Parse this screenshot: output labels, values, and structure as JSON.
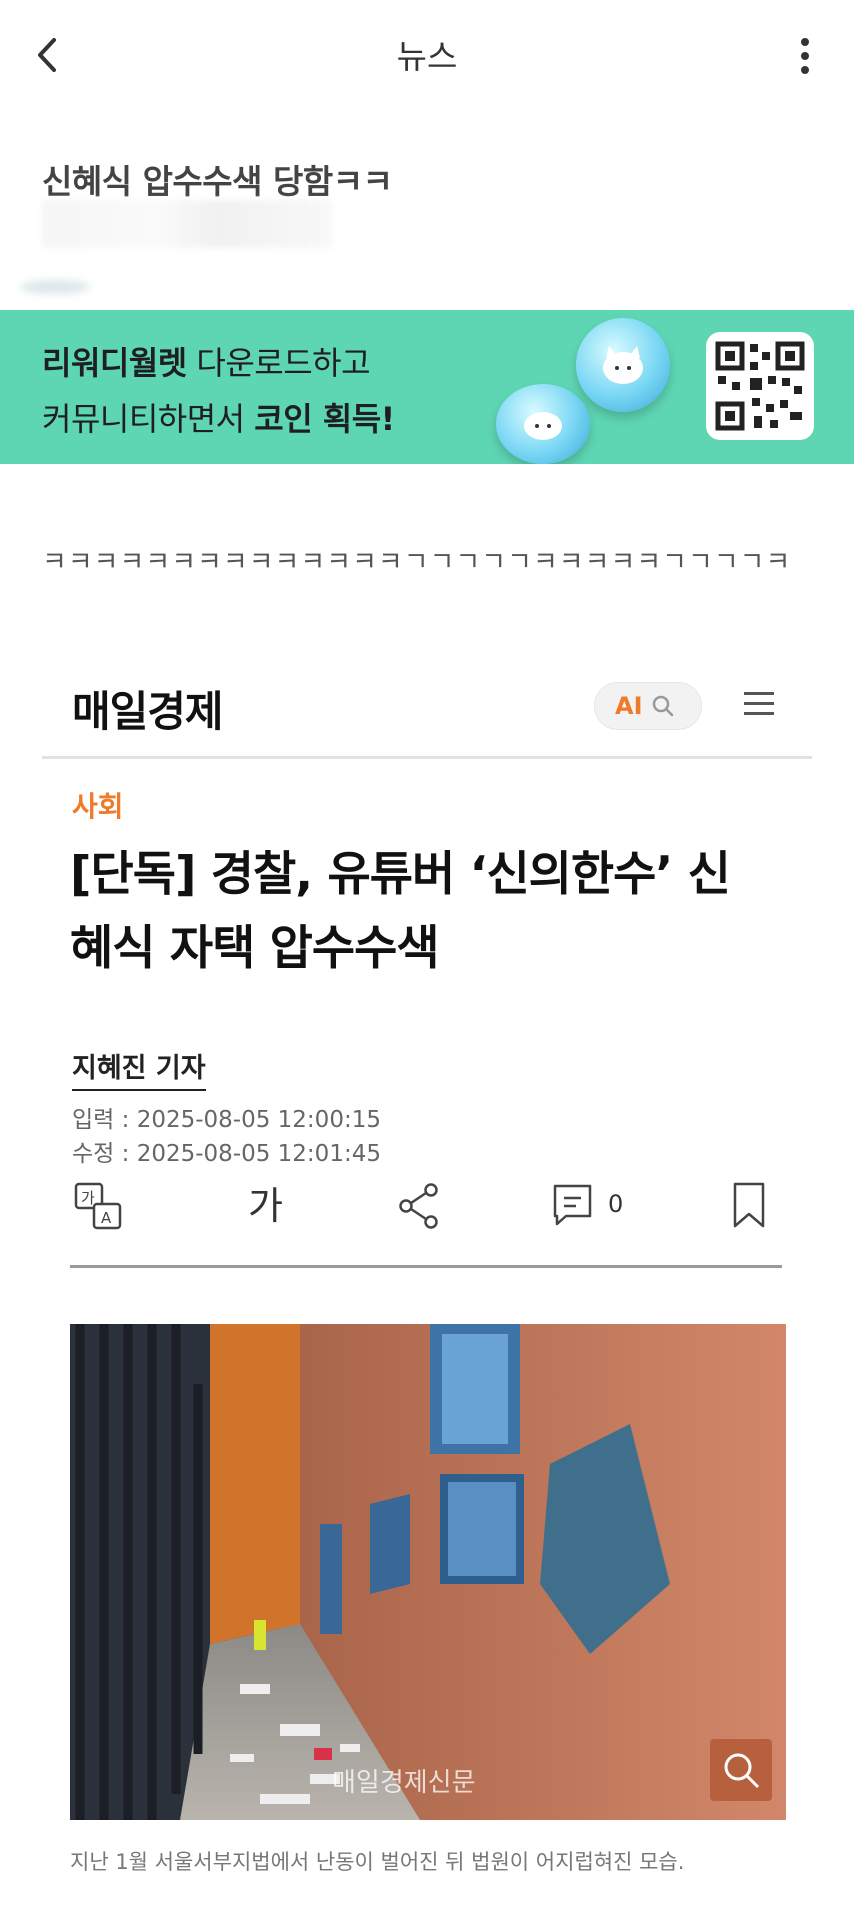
{
  "header": {
    "title": "뉴스",
    "back_icon": "chevron-left-icon",
    "more_icon": "vertical-dots-icon"
  },
  "post": {
    "title": "신혜식 압수수색 당함ㅋㅋ",
    "body_text": "ㅋㅋㅋㅋㅋㅋㅋㅋㅋㅋㅋㅋㅋㅋㄱㄱㄱㄱㄱㅋㅋㅋㅋㅋㄱㄱㄱㄱㅋ"
  },
  "banner": {
    "line1_bold": "리워디월렛",
    "line1_rest": " 다운로드하고",
    "line2_rest": "커뮤니티하면서 ",
    "line2_bold": "코인 획득!",
    "bg_color": "#5ed6b4"
  },
  "article": {
    "brand": "매일경제",
    "ai_label": "AI",
    "category": "사회",
    "headline_line1": "[단독] 경찰, 유튜버 ‘신의한수’ 신",
    "headline_line2": "혜식 자택 압수수색",
    "reporter": "지혜진 기자",
    "input_date": "입력 : 2025-08-05 12:00:15",
    "edit_date": "수정 : 2025-08-05 12:01:45",
    "toolbar": {
      "translate_icon": "translate-icon",
      "font_label": "가",
      "share_icon": "share-icon",
      "comment_count": "0",
      "bookmark_icon": "bookmark-icon"
    },
    "photo_watermark": "매일경제신문",
    "caption": "지난 1월 서울서부지법에서 난동이 벌어진 뒤 법원이 어지럽혀진 모습.",
    "accent_color": "#ef7a2a"
  }
}
